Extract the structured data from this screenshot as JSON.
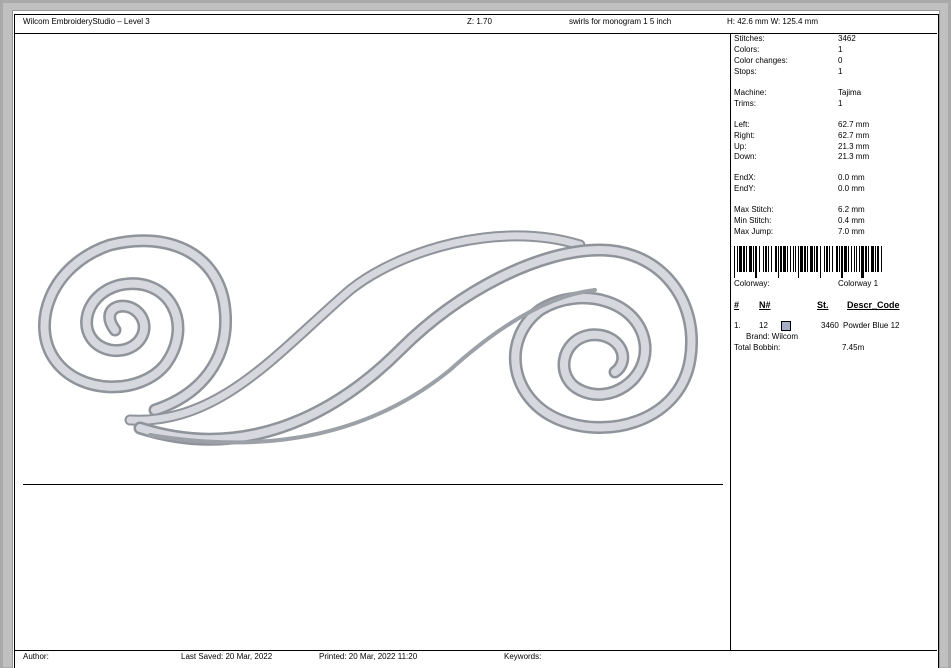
{
  "header": {
    "app_title": "Wilcom EmbroideryStudio – Level 3",
    "zoom": "Z: 1.70",
    "design_name": "swirls  for monogram 1 5  inch",
    "dimensions": "H: 42.6 mm   W: 125.4 mm"
  },
  "stats": [
    {
      "label": "Stitches:",
      "value": "3462"
    },
    {
      "label": "Colors:",
      "value": "1"
    },
    {
      "label": "Color changes:",
      "value": "0"
    },
    {
      "label": "Stops:",
      "value": "1"
    },
    {
      "label": "Machine:",
      "value": "Tajima"
    },
    {
      "label": "Trims:",
      "value": "1"
    },
    {
      "label": "Left:",
      "value": "62.7 mm"
    },
    {
      "label": "Right:",
      "value": "62.7 mm"
    },
    {
      "label": "Up:",
      "value": "21.3 mm"
    },
    {
      "label": "Down:",
      "value": "21.3 mm"
    },
    {
      "label": "EndX:",
      "value": "0.0 mm"
    },
    {
      "label": "EndY:",
      "value": "0.0 mm"
    },
    {
      "label": "Max Stitch:",
      "value": "6.2 mm"
    },
    {
      "label": "Min Stitch:",
      "value": "0.4 mm"
    },
    {
      "label": "Max Jump:",
      "value": "7.0 mm"
    }
  ],
  "colorway": {
    "label": "Colorway:",
    "value": "Colorway 1"
  },
  "thread_table": {
    "headers": [
      "#",
      "N#",
      "St.",
      "Descr_Code"
    ],
    "rows": [
      {
        "index": "1.",
        "number": "12",
        "stitches": "3460",
        "description": "Powder Blue 12",
        "swatch_color": "#a7adc4"
      }
    ],
    "brand": "Brand: Wilcom",
    "total_bobbin_label": "Total Bobbin:",
    "total_bobbin_value": "7.45m"
  },
  "footer": {
    "author": "Author:",
    "last_saved": "Last Saved: 20 Mar, 2022",
    "printed": "Printed: 20 Mar, 2022 11:20",
    "keywords": "Keywords:"
  },
  "colors": {
    "thread": "#c4c6cc",
    "thread_dark": "#8c8f96",
    "thread_light": "#eceef2"
  }
}
